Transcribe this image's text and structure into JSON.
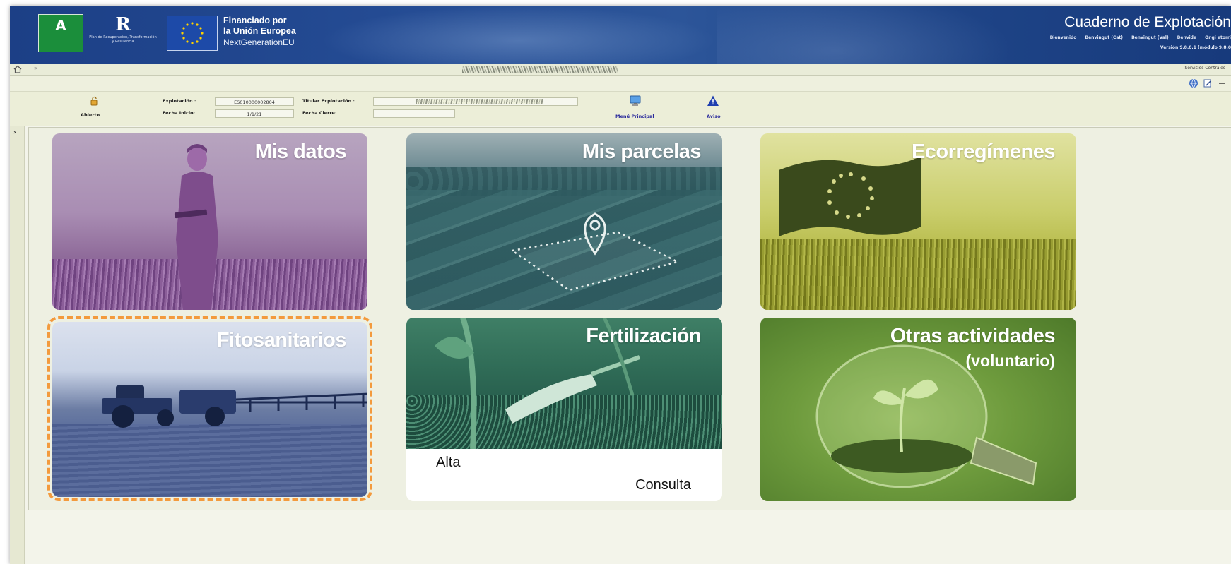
{
  "banner": {
    "junta_logo_letter": "A",
    "plan_logo_letter": "R",
    "plan_logo_text": "Plan de Recuperación, Transformación y Resiliencia",
    "eu_line1": "Financiado por",
    "eu_line2": "la Unión Europea",
    "eu_line3": "NextGenerationEU",
    "app_title": "Cuaderno de Explotación",
    "user_links": [
      "Bienvenido",
      "Benvingut (Cat)",
      "Benvingut (Val)",
      "Benvide",
      "Ongi etorri"
    ],
    "version": "Versión 9.8.0.1 (módulo 9.8.0"
  },
  "breadcrumb": {
    "separator": "»",
    "office": "Servicios Centrales"
  },
  "infobar": {
    "status_label": "Abierto",
    "explotacion_label": "Explotación :",
    "explotacion_value": "ES010000002804",
    "fecha_inicio_label": "Fecha Inicio:",
    "fecha_inicio_value": "1/1/21",
    "titular_label": "Titular Explotación :",
    "fecha_cierre_label": "Fecha Cierre:",
    "menu_principal": "Menú Principal",
    "aviso": "Aviso"
  },
  "gutter": {
    "toggle": "›"
  },
  "tiles": {
    "mis_datos": "Mis datos",
    "mis_parcelas": "Mis parcelas",
    "ecorregimenes": "Ecorregímenes",
    "fitosanitarios": "Fitosanitarios",
    "fertilizacion": "Fertilización",
    "fertilizacion_alta": "Alta",
    "fertilizacion_consulta": "Consulta",
    "otras_actividades": "Otras actividades",
    "otras_voluntario": "(voluntario)"
  },
  "colors": {
    "banner_blue": "#244b93",
    "highlight_orange": "#f39a3d",
    "mis_datos_tint": "#8f6b9a",
    "parcelas_tint": "#2f5e63",
    "eco_tint": "#b0b440",
    "fito_tint": "#56699a",
    "fert_tint": "#2f6b56",
    "otras_tint": "#6e9b3d"
  }
}
